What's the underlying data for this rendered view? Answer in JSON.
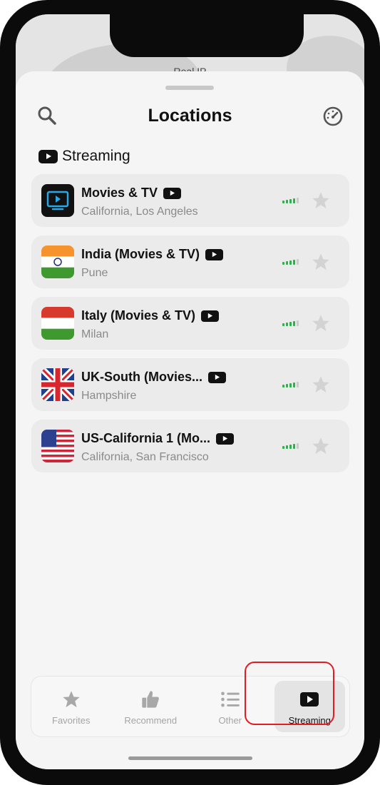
{
  "map": {
    "label": "Real IP"
  },
  "header": {
    "title": "Locations"
  },
  "section": {
    "label": "Streaming"
  },
  "locations": [
    {
      "name": "Movies & TV",
      "sub": "California, Los Angeles",
      "thumb": "tv-icon",
      "signal": 4
    },
    {
      "name": "India (Movies & TV)",
      "sub": "Pune",
      "thumb": "india-flag",
      "signal": 4
    },
    {
      "name": "Italy (Movies & TV)",
      "sub": "Milan",
      "thumb": "italy-flag",
      "signal": 4
    },
    {
      "name": "UK-South (Movies...",
      "sub": "Hampshire",
      "thumb": "uk-flag",
      "signal": 4
    },
    {
      "name": "US-California 1 (Mo...",
      "sub": "California, San Francisco",
      "thumb": "us-flag",
      "signal": 4
    }
  ],
  "tabs": [
    {
      "label": "Favorites",
      "icon": "star-icon"
    },
    {
      "label": "Recommend",
      "icon": "thumbs-up-icon"
    },
    {
      "label": "Other",
      "icon": "list-icon"
    },
    {
      "label": "Streaming",
      "icon": "play-icon",
      "active": true
    }
  ],
  "colors": {
    "signal": "#2bb24c",
    "highlight": "#e31b23",
    "text": "#111111",
    "subtext": "#8a8a8a"
  }
}
